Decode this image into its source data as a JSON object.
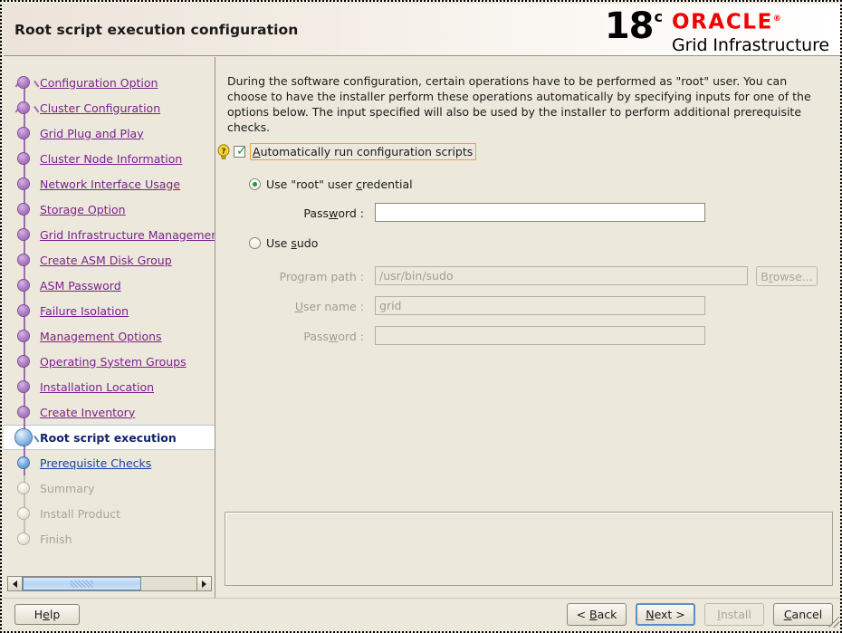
{
  "header": {
    "title": "Root script execution configuration",
    "logo": {
      "version": "18",
      "superscript": "c",
      "brand": "ORACLE",
      "registered": "®",
      "product": "Grid Infrastructure"
    }
  },
  "sidebar": {
    "items": [
      {
        "label": "Configuration Option",
        "state": "done",
        "marker": "branch"
      },
      {
        "label": "Cluster Configuration",
        "state": "done",
        "marker": "branch"
      },
      {
        "label": "Grid Plug and Play",
        "state": "done",
        "marker": "dot"
      },
      {
        "label": "Cluster Node Information",
        "state": "done",
        "marker": "dot"
      },
      {
        "label": "Network Interface Usage",
        "state": "done",
        "marker": "dot"
      },
      {
        "label": "Storage Option",
        "state": "done",
        "marker": "dot"
      },
      {
        "label": "Grid Infrastructure Managemen",
        "state": "done",
        "marker": "dot"
      },
      {
        "label": "Create ASM Disk Group",
        "state": "done",
        "marker": "dot"
      },
      {
        "label": "ASM Password",
        "state": "done",
        "marker": "dot"
      },
      {
        "label": "Failure Isolation",
        "state": "done",
        "marker": "dot"
      },
      {
        "label": "Management Options",
        "state": "done",
        "marker": "dot"
      },
      {
        "label": "Operating System Groups",
        "state": "done",
        "marker": "dot"
      },
      {
        "label": "Installation Location",
        "state": "done",
        "marker": "dot"
      },
      {
        "label": "Create Inventory",
        "state": "done",
        "marker": "dot"
      },
      {
        "label": "Root script execution",
        "state": "current",
        "marker": "current"
      },
      {
        "label": "Prerequisite Checks",
        "state": "next",
        "marker": "blue"
      },
      {
        "label": "Summary",
        "state": "disabled",
        "marker": "gray"
      },
      {
        "label": "Install Product",
        "state": "disabled",
        "marker": "gray"
      },
      {
        "label": "Finish",
        "state": "disabled",
        "marker": "gray"
      }
    ],
    "scrollbar": {
      "left_arrow": "◀",
      "right_arrow": "▶"
    }
  },
  "main": {
    "description": "During the software configuration, certain operations have to be performed as \"root\" user. You can choose to have the installer perform these operations automatically by specifying inputs for one of the options below. The input specified will also be used by the installer to perform additional prerequisite checks.",
    "auto_run_checkbox": {
      "label_before": "A",
      "label_mnemonic": "A",
      "label": "utomatically run configuration scripts",
      "full_label": "Automatically run configuration scripts",
      "checked": true,
      "hint_icon": "lightbulb-help-icon"
    },
    "root_credential": {
      "label_pre": "Use \"root\" user ",
      "label_mnemonic": "c",
      "label_post": "redential",
      "full_label": "Use \"root\" user credential",
      "selected": true,
      "password": {
        "label_pre": "Pass",
        "label_mnemonic": "w",
        "label_post": "ord :",
        "full_label": "Password :",
        "value": "",
        "enabled": true
      }
    },
    "sudo": {
      "label_pre": "Use ",
      "label_mnemonic": "s",
      "label_post": "udo",
      "full_label": "Use sudo",
      "selected": false,
      "program_path": {
        "label_pre": "Pro",
        "label_mnemonic": "g",
        "label_post": "ram path :",
        "full_label": "Program path :",
        "value": "/usr/bin/sudo",
        "enabled": false
      },
      "user_name": {
        "label_pre": "",
        "label_mnemonic": "U",
        "label_post": "ser name :",
        "full_label": "User name :",
        "value": "grid",
        "enabled": false
      },
      "password": {
        "label_pre": "Pass",
        "label_mnemonic": "w",
        "label_post": "ord :",
        "full_label": "Password :",
        "value": "",
        "enabled": false
      },
      "browse_button": {
        "label_pre": "B",
        "label_mnemonic": "r",
        "label_post": "owse...",
        "full_label": "Browse...",
        "enabled": false
      }
    },
    "message_panel": {
      "text": ""
    }
  },
  "footer": {
    "help": {
      "label_pre": "H",
      "label_mnemonic": "e",
      "label_post": "lp",
      "full_label": "Help"
    },
    "back": {
      "label_pre": "< ",
      "label_mnemonic": "B",
      "label_post": "ack",
      "full_label": "< Back"
    },
    "next": {
      "label_pre": "",
      "label_mnemonic": "N",
      "label_post": "ext >",
      "full_label": "Next >",
      "focused": true
    },
    "install": {
      "label_pre": "",
      "label_mnemonic": "I",
      "label_post": "nstall",
      "full_label": "Install",
      "enabled": false
    },
    "cancel": {
      "label_pre": "",
      "label_mnemonic": "C",
      "label_post": "ancel",
      "full_label": "Cancel"
    }
  },
  "colors": {
    "background": "#ece9dc",
    "link": "#7d1f8e",
    "link_next": "#1a3f9e",
    "current": "#12246e",
    "disabled_text": "#a8a499",
    "oracle_red": "#f00000",
    "focus_orange": "#e8a33d",
    "focus_blue": "#5b8ec4",
    "check_green": "#159b2e"
  }
}
